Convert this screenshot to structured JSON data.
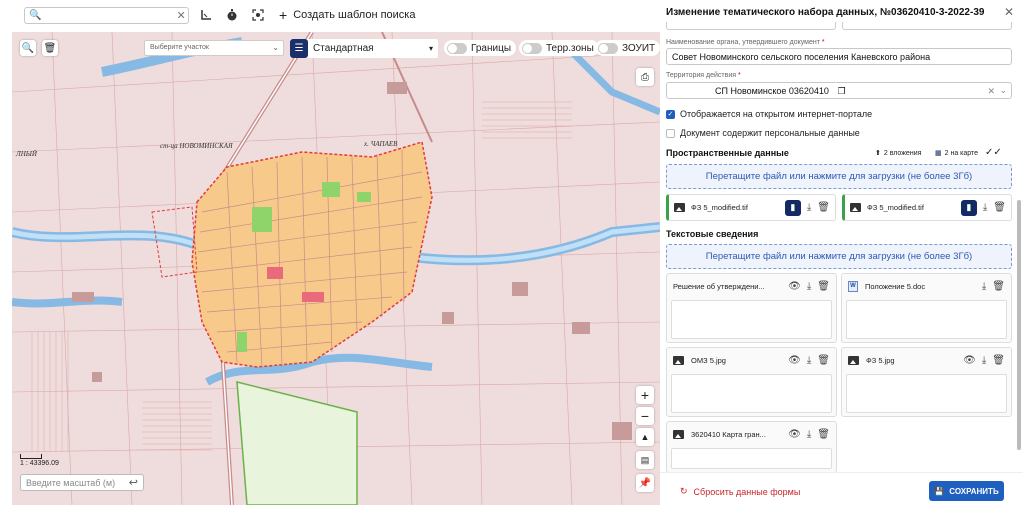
{
  "toolbar": {
    "search": {
      "value": "",
      "placeholder": ""
    },
    "create_template_label": "Создать шаблон поиска",
    "icons": [
      "search-icon",
      "clear-icon",
      "ruler-icon",
      "timer-icon",
      "focus-icon",
      "plus-icon"
    ]
  },
  "map": {
    "layer_select_placeholder": "Выберите участок",
    "base_layer_label": "Стандартная",
    "toggles": [
      {
        "label": "Границы",
        "on": false
      },
      {
        "label": "Терр.зоны",
        "on": false
      },
      {
        "label": "ЗОУИТ",
        "on": false
      }
    ],
    "place_labels": [
      "ст-ца НОВОМИНСКАЯ",
      "х. ЧАПАЕВ",
      "ЛНЫЙ"
    ],
    "scale_text": "1 : 43396.09",
    "scale_input_placeholder": "Введите масштаб (м)",
    "colors": {
      "background": "#efdcdc",
      "town": "#f7c98a",
      "river": "#9ec9ea",
      "road": "#c98a8a",
      "boundary": "#e23a3a"
    }
  },
  "panel": {
    "title": "Изменение тематического набора данных, №03620410-3-2022-39",
    "organ_label": "Наименование органа, утвердившего документ",
    "organ_value": "Совет Новоминского сельского поселения Каневского района",
    "territory_label": "Территория действия",
    "territory_value": "СП Новоминское 03620410",
    "checkbox_portal": "Отображается на открытом интернет-портале",
    "checkbox_personal": "Документ содержит персональные данные",
    "spatial_title": "Пространственные данные",
    "spatial_attachments": "2 вложения",
    "spatial_on_map": "2 на карте",
    "dropzone_text": "Перетащите файл или нажмите для загрузки (не более 3Гб)",
    "spatial_files": [
      "ФЗ 5_modified.tif",
      "ФЗ 5_modified.tif"
    ],
    "text_title": "Текстовые сведения",
    "text_dropzone": "Перетащите файл или нажмите для загрузки (не более 3Гб)",
    "docs": [
      "Решение об утверждени...",
      "Положение 5.doc",
      "ОМЗ 5.jpg",
      "ФЗ 5.jpg",
      "3620410 Карта гран..."
    ],
    "reset_label": "Сбросить данные формы",
    "save_label": "СОХРАНИТЬ",
    "accent": "#1e5fbf"
  }
}
